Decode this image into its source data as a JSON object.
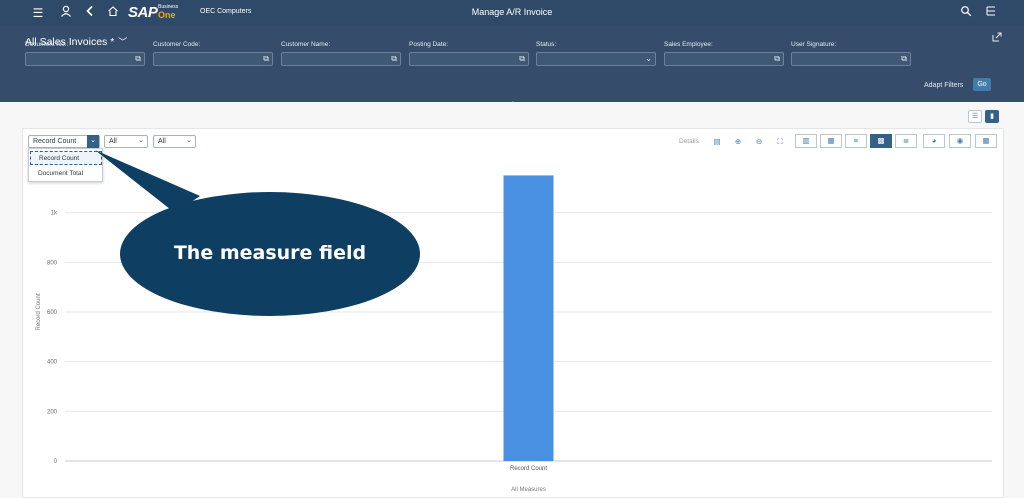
{
  "shell": {
    "brand_sap": "SAP",
    "brand_business": "Business",
    "brand_one": "One",
    "company": "OEC Computers",
    "title": "Manage A/R Invoice"
  },
  "header": {
    "variant": "All Sales Invoices *",
    "filters": [
      {
        "label": "Document No.:",
        "value": ""
      },
      {
        "label": "Customer Code:",
        "value": ""
      },
      {
        "label": "Customer Name:",
        "value": ""
      },
      {
        "label": "Posting Date:",
        "value": ""
      },
      {
        "label": "Status:",
        "value": ""
      },
      {
        "label": "Sales Employee:",
        "value": ""
      },
      {
        "label": "User Signature:",
        "value": ""
      }
    ],
    "adapt_filters": "Adapt Filters",
    "go": "Go"
  },
  "chart_toolbar": {
    "measure_value": "Record Count",
    "select2_value": "All",
    "select3_value": "All",
    "measure_options": [
      "Record Count",
      "Document Total"
    ],
    "details": "Details"
  },
  "callout": {
    "text": "The measure field",
    "fill": "#0e3f63"
  },
  "colors": {
    "shell": "#2f4a68",
    "header": "#354d6b",
    "bar": "#4a90e2",
    "accent": "#346187"
  },
  "chart_data": {
    "type": "bar",
    "categories": [
      "Record Count"
    ],
    "values": [
      1150
    ],
    "xlabel": "All Measures",
    "ylabel": "Record Count",
    "yticks": [
      "0",
      "200",
      "400",
      "600",
      "800",
      "1k"
    ],
    "ylim": [
      0,
      1200
    ],
    "grid": true
  }
}
